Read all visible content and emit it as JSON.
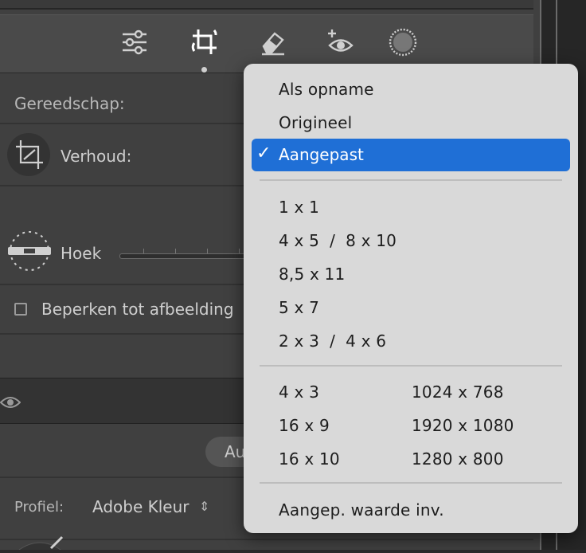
{
  "panel": {
    "tools_label": "Gereedschap:",
    "ratio_label": "Verhoud:",
    "angle_label": "Hoek",
    "constrain_label": "Beperken tot afbeelding",
    "auto_partial": "Au",
    "profile_label": "Profiel:",
    "profile_value": "Adobe Kleur",
    "profile_chevron": "⇕"
  },
  "icons": {
    "sliders": "sliders-icon",
    "crop": "crop-rotate-icon",
    "eraser": "eraser-icon",
    "redeye": "redeye-icon",
    "mask": "mask-icon"
  },
  "menu": {
    "items_top": [
      "Als opname",
      "Origineel"
    ],
    "selected": "Aangepast",
    "check": "✓",
    "ratios": [
      "1 x 1",
      "4 x 5  /  8 x 10",
      "8,5 x 11",
      "5 x 7",
      "2 x 3  /  4 x 6"
    ],
    "ratios_left": [
      "4 x 3",
      "16 x 9",
      "16 x 10"
    ],
    "ratios_right": [
      "1024 x 768",
      "1920 x 1080",
      "1280 x 800"
    ],
    "custom_entry": "Aangep. waarde inv."
  },
  "colors": {
    "selection": "#1f6fd6",
    "menu_bg": "#d9d9d9",
    "panel_bg": "#404040"
  }
}
